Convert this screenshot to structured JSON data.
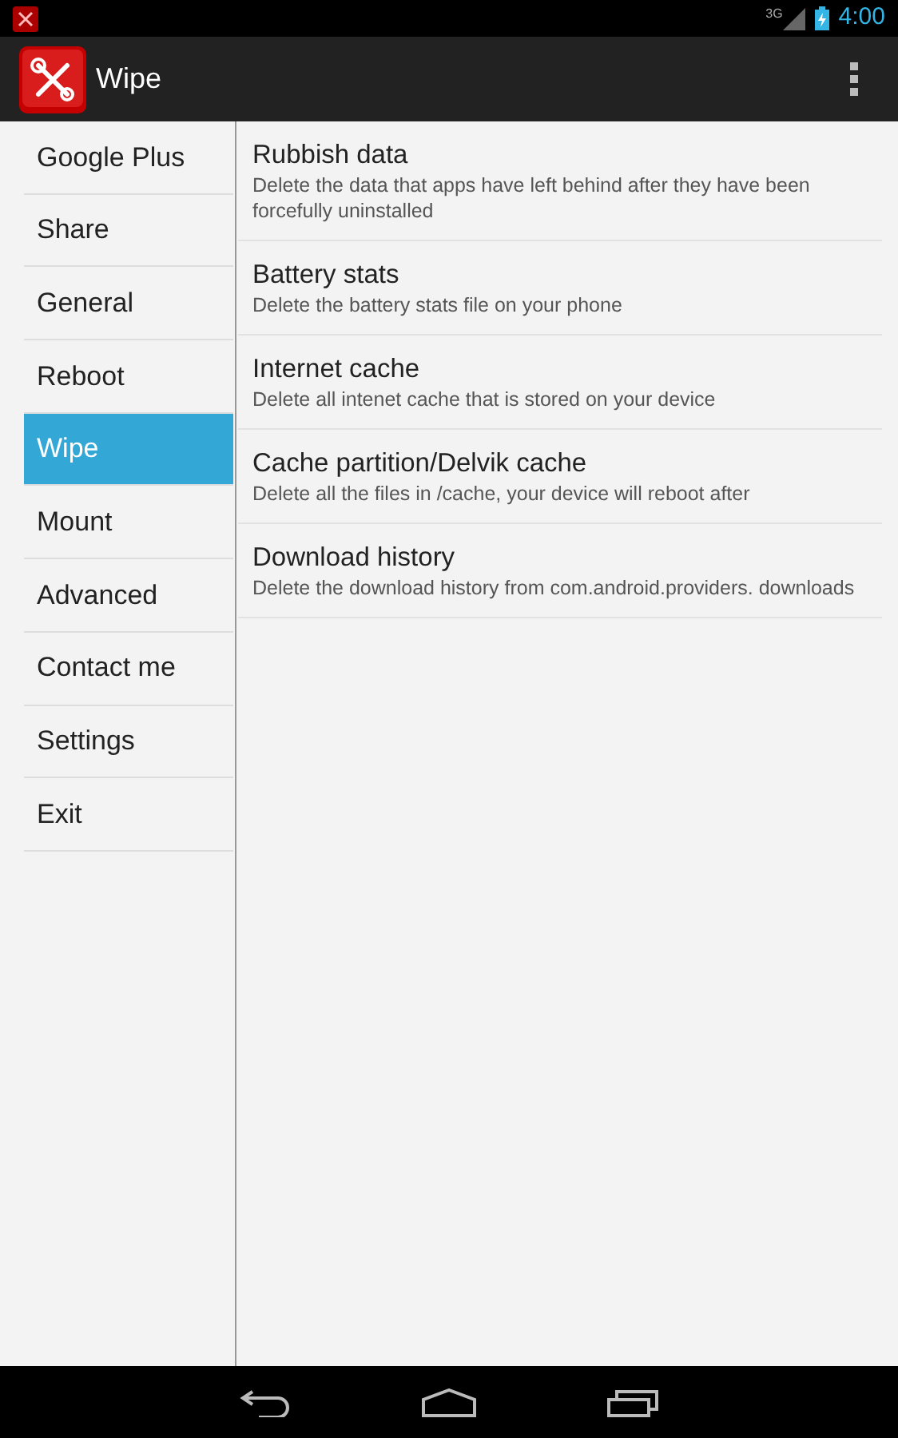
{
  "status_bar": {
    "network": "3G",
    "time": "4:00"
  },
  "action_bar": {
    "title": "Wipe"
  },
  "sidebar": {
    "items": [
      {
        "label": "Google Plus",
        "selected": false
      },
      {
        "label": "Share",
        "selected": false
      },
      {
        "label": "General",
        "selected": false
      },
      {
        "label": "Reboot",
        "selected": false
      },
      {
        "label": "Wipe",
        "selected": true
      },
      {
        "label": "Mount",
        "selected": false
      },
      {
        "label": "Advanced",
        "selected": false
      },
      {
        "label": "Contact me",
        "selected": false
      },
      {
        "label": "Settings",
        "selected": false
      },
      {
        "label": "Exit",
        "selected": false
      }
    ]
  },
  "options": [
    {
      "title": "Rubbish data",
      "summary": "Delete the data that apps have left behind after they have been forcefully uninstalled"
    },
    {
      "title": "Battery stats",
      "summary": "Delete the battery stats file on your phone"
    },
    {
      "title": "Internet cache",
      "summary": "Delete all intenet cache that is stored on your device"
    },
    {
      "title": "Cache partition/Delvik cache",
      "summary": "Delete all the files in /cache, your device will reboot after"
    },
    {
      "title": "Download history",
      "summary": "Delete the download history from com.android.providers. downloads"
    }
  ]
}
